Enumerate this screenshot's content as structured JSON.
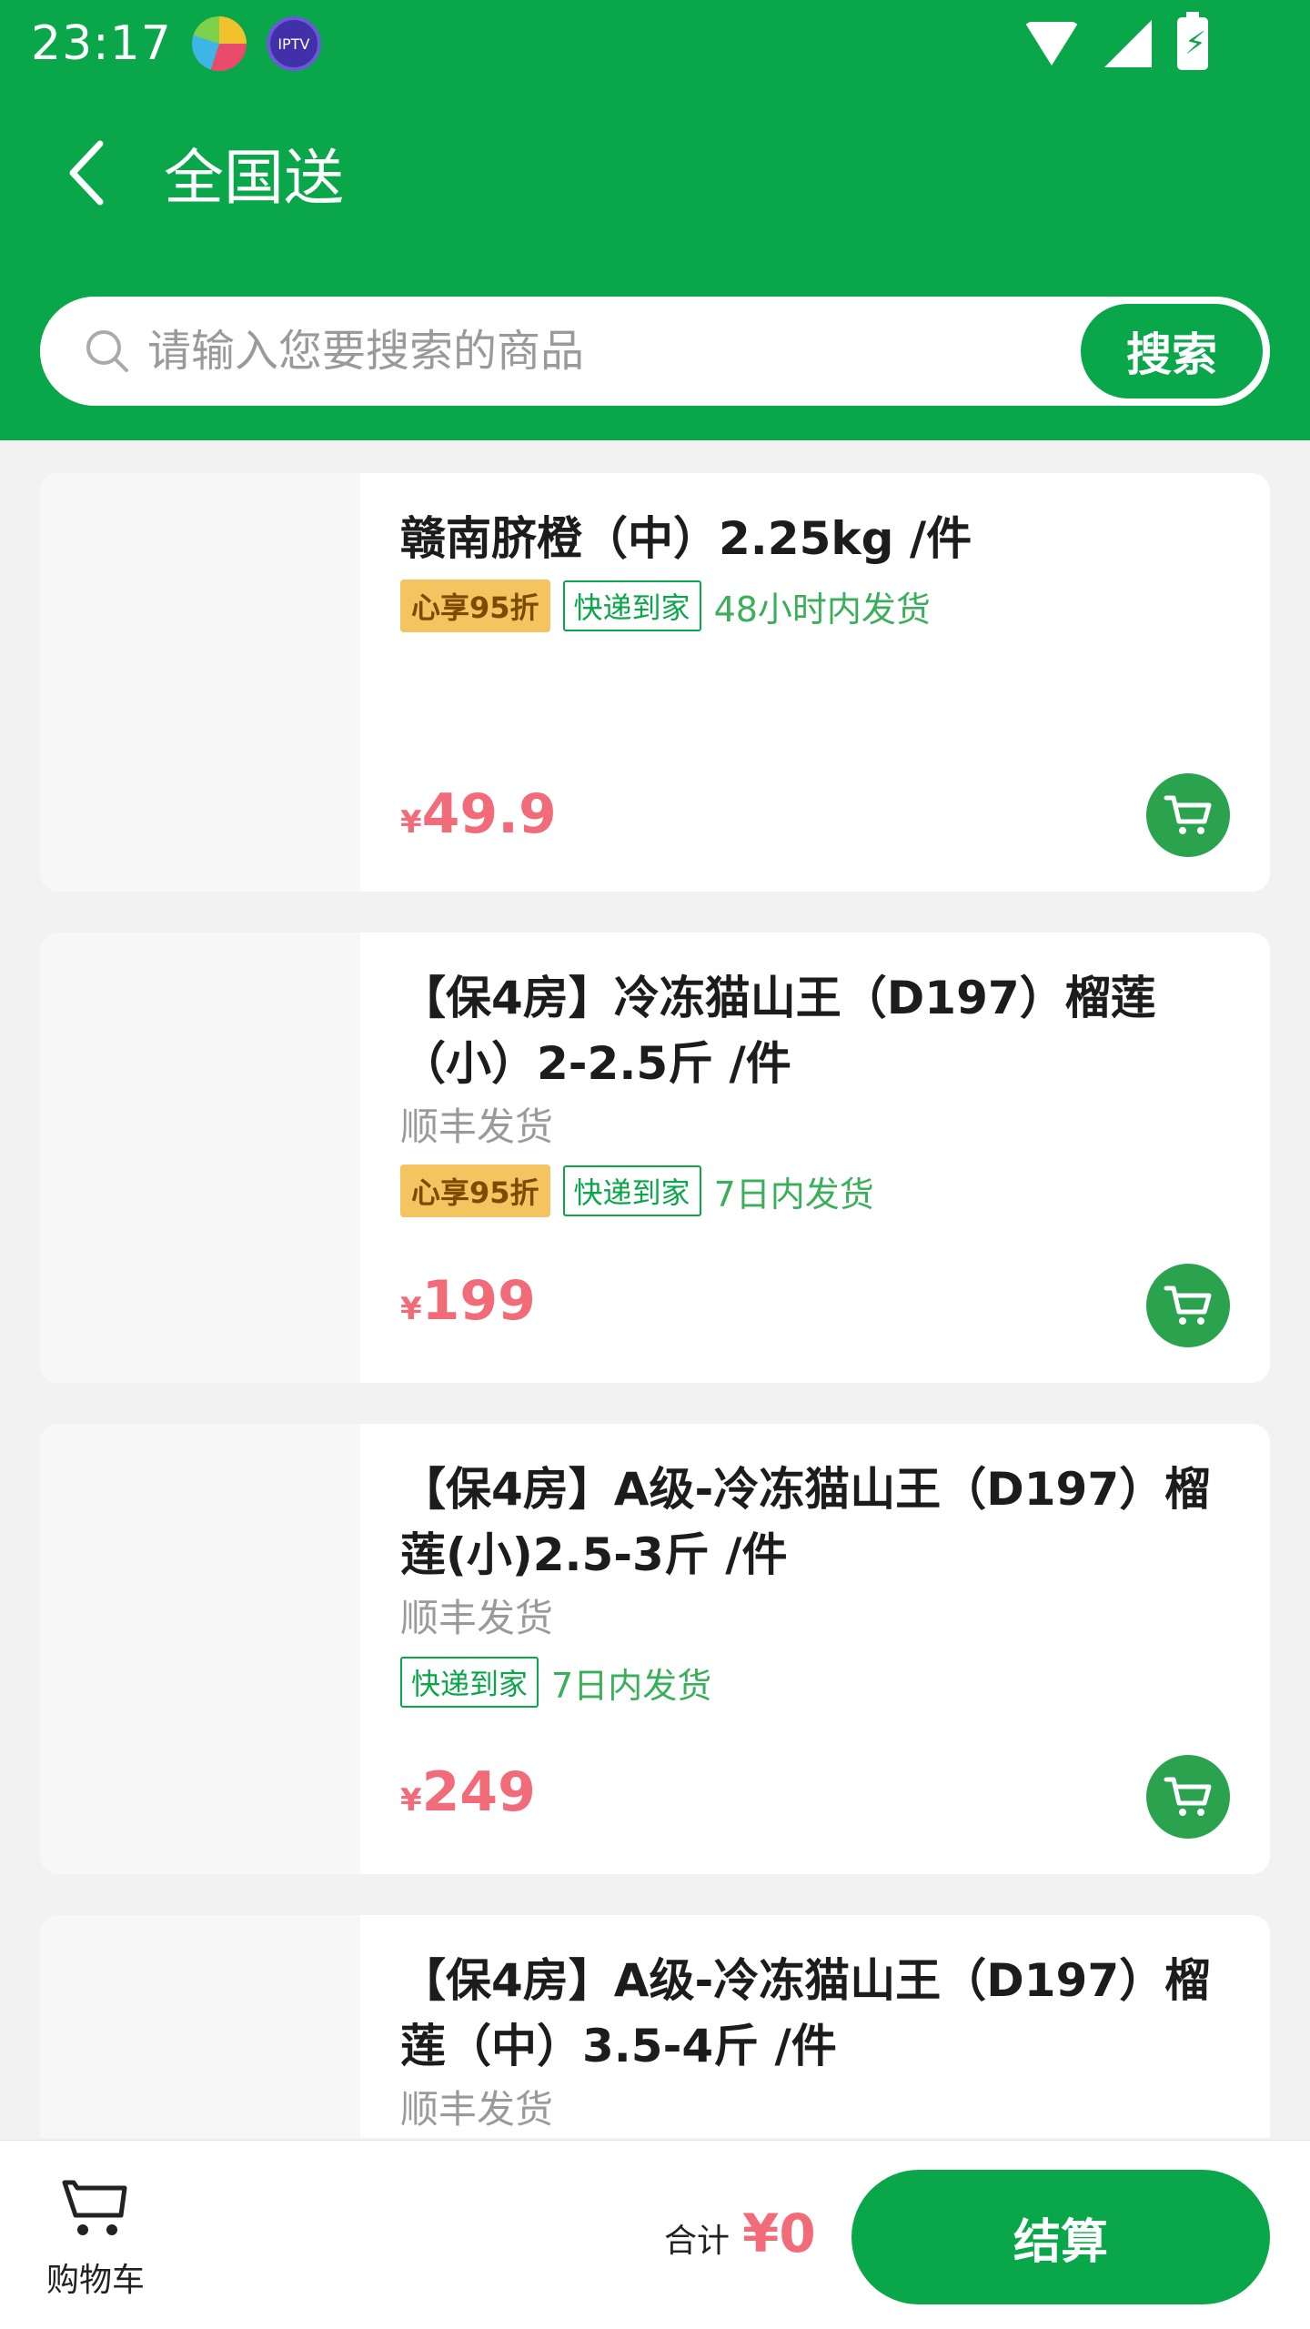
{
  "status_bar": {
    "time": "23:17",
    "iptv_label": "IPTV"
  },
  "header": {
    "title": "全国送",
    "back_icon": "chevron-left-icon"
  },
  "search": {
    "placeholder": "请输入您要搜索的商品",
    "button_label": "搜索"
  },
  "products": [
    {
      "name": "赣南脐橙（中）2.25kg /件",
      "shipping_note": "",
      "discount_tag": "心享95折",
      "express_tag": "快递到家",
      "ship_time": "48小时内发货",
      "currency": "¥",
      "price": "49.9"
    },
    {
      "name": "【保4房】冷冻猫山王（D197）榴莲（小）2-2.5斤 /件",
      "shipping_note": "顺丰发货",
      "discount_tag": "心享95折",
      "express_tag": "快递到家",
      "ship_time": "7日内发货",
      "currency": "¥",
      "price": "199"
    },
    {
      "name": "【保4房】A级-冷冻猫山王（D197）榴莲(小)2.5-3斤 /件",
      "shipping_note": "顺丰发货",
      "discount_tag": "",
      "express_tag": "快递到家",
      "ship_time": "7日内发货",
      "currency": "¥",
      "price": "249"
    },
    {
      "name": "【保4房】A级-冷冻猫山王（D197）榴莲（中）3.5-4斤 /件",
      "shipping_note": "顺丰发货"
    }
  ],
  "bottom_bar": {
    "cart_label": "购物车",
    "total_label": "合计",
    "total_currency": "¥",
    "total_value": "0",
    "checkout_label": "结算"
  },
  "colors": {
    "brand_green": "#0aa64a",
    "price_pink": "#f16b78",
    "discount_tag": "#f4c460"
  }
}
